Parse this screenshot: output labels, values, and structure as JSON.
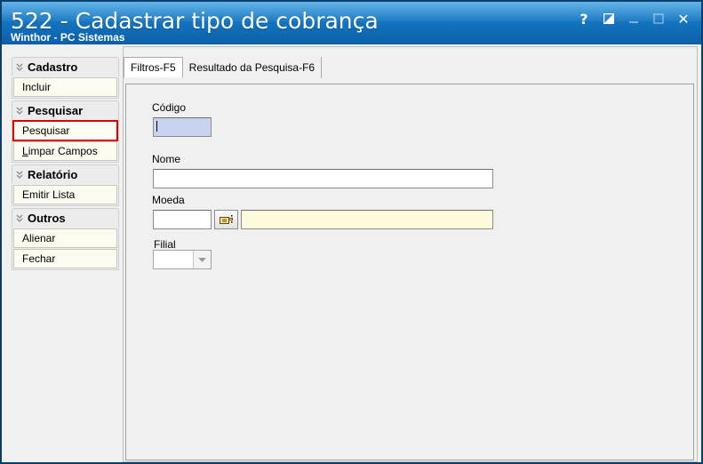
{
  "window": {
    "title": "522 - Cadastrar tipo de cobrança",
    "subtitle": "Winthor - PC Sistemas",
    "controls": {
      "help": "?",
      "close": "✕"
    }
  },
  "sidebar": {
    "groups": [
      {
        "label": "Cadastro",
        "items": [
          {
            "label": "Incluir"
          }
        ]
      },
      {
        "label": "Pesquisar",
        "items": [
          {
            "label": "Pesquisar",
            "selected": true
          },
          {
            "label": "Limpar Campos",
            "mnemonic": "L",
            "rest": "impar Campos"
          }
        ]
      },
      {
        "label": "Relatório",
        "items": [
          {
            "label": "Emitir Lista"
          }
        ]
      },
      {
        "label": "Outros",
        "items": [
          {
            "label": "Alienar"
          },
          {
            "label": "Fechar"
          }
        ]
      }
    ]
  },
  "tabs": [
    {
      "label": "Filtros-F5",
      "active": true
    },
    {
      "label": "Resultado da Pesquisa-F6",
      "active": false
    }
  ],
  "form": {
    "codigo": {
      "label": "Código",
      "value": ""
    },
    "nome": {
      "label": "Nome",
      "value": ""
    },
    "moeda": {
      "label": "Moeda",
      "code": "",
      "description": ""
    },
    "filial": {
      "label": "Filial",
      "value": ""
    }
  },
  "colors": {
    "title_bar": "#1577c2",
    "selected_outline": "#e00000",
    "focused_field": "#c8d4ef",
    "readonly_field": "#fdfbdc"
  },
  "icons": {
    "group_chevron": "double-chevron-down-icon",
    "lookup": "hand-pointer-icon"
  }
}
